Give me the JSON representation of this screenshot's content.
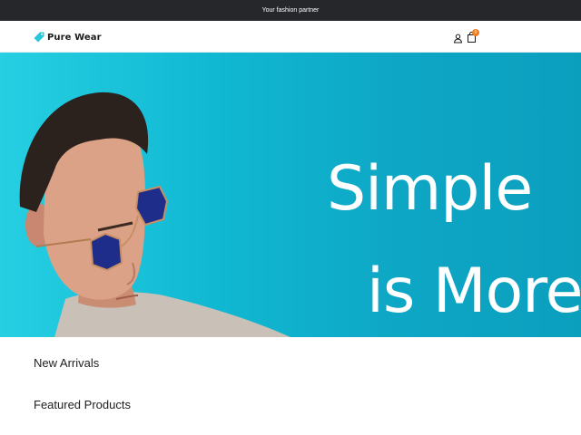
{
  "announcement": {
    "text": "Your fashion partner"
  },
  "brand": {
    "name": "Pure Wear",
    "accent": "#27c6d8"
  },
  "header": {
    "account_icon": "user-icon",
    "cart_icon": "shopping-bag-icon",
    "cart_count": "0",
    "badge_color": "#f07a1c"
  },
  "hero": {
    "line1": "Simple",
    "line2": "is More",
    "background": "#11b9d3"
  },
  "sections": {
    "new_arrivals": "New Arrivals",
    "featured": "Featured Products"
  }
}
